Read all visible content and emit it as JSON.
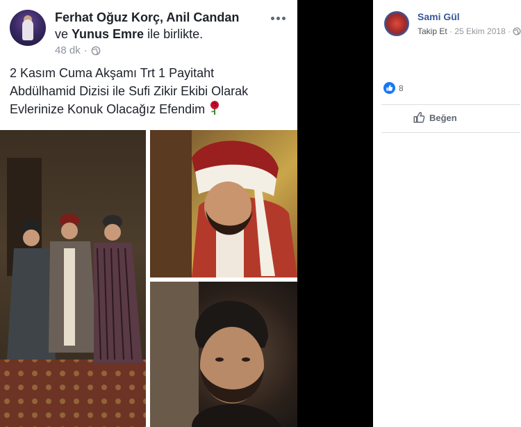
{
  "post": {
    "authors_main": "Ferhat Oğuz Korç, Anil Candan",
    "with_prefix": "ve",
    "with_name": "Yunus Emre",
    "with_suffix": "ile birlikte.",
    "time": "48 dk",
    "separator": "·",
    "text_lines": [
      "2 Kasım Cuma Akşamı Trt 1 Payitaht",
      "Abdülhamid Dizisi ile Sufi Zikir Ekibi Olarak",
      "Evlerinize Konuk Olacağız Efendim"
    ],
    "icons": {
      "options": "more-options-icon",
      "privacy": "globe-icon",
      "emoji": "rose-emoji"
    }
  },
  "panel": {
    "name": "Sami Gül",
    "follow": "Takip Et",
    "dot": "·",
    "date": "25 Ekim 2018",
    "dot2": "·",
    "reactions_count": "8",
    "like_label": "Beğen",
    "colors": {
      "link": "#385898",
      "like": "#1877f2"
    }
  }
}
